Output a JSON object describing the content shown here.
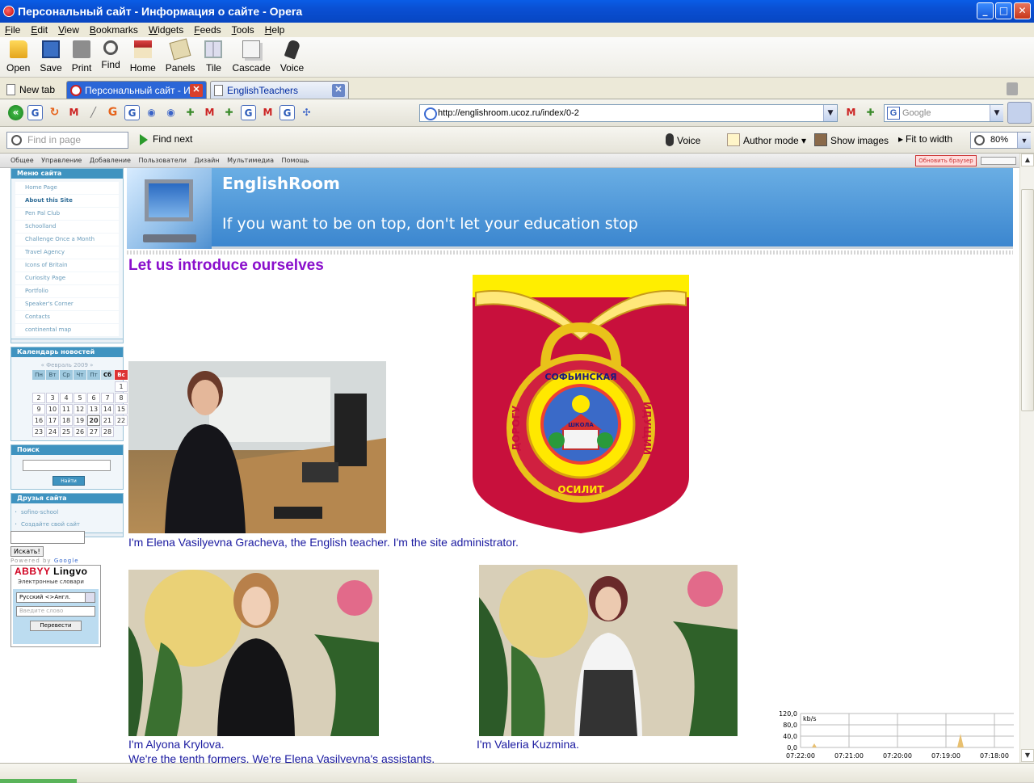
{
  "window": {
    "title": "Персональный сайт - Информация о сайте - Opera"
  },
  "menubar": [
    "File",
    "Edit",
    "View",
    "Bookmarks",
    "Widgets",
    "Feeds",
    "Tools",
    "Help"
  ],
  "toolbar": {
    "open": "Open",
    "save": "Save",
    "print": "Print",
    "find": "Find",
    "home": "Home",
    "panels": "Panels",
    "tile": "Tile",
    "cascade": "Cascade",
    "voice": "Voice"
  },
  "tabs": {
    "new_tab": "New tab",
    "active": "Персональный сайт - И...",
    "other": "EnglishTeachers"
  },
  "address": {
    "url": "http://englishroom.ucoz.ru/index/0-2",
    "search_placeholder": "Google"
  },
  "findbar": {
    "placeholder": "Find in page",
    "find_next": "Find next",
    "voice": "Voice",
    "author_mode": "Author mode",
    "show_images": "Show images",
    "fit_to_width": "Fit to width",
    "zoom": "80%"
  },
  "ucoz_panel": {
    "items": [
      "Общее",
      "Управление",
      "Добавление",
      "Пользователи",
      "Дизайн",
      "Мультимедиа",
      "Помощь"
    ],
    "refresh": "Обновить браузер"
  },
  "sidebar": {
    "menu_title": "Меню сайта",
    "menu_items": [
      "Home Page",
      "About this Site",
      "Pen Pal Club",
      "Schoolland",
      "Challenge Once a Month",
      "Travel Agency",
      "Icons of Britain",
      "Curiosity Page",
      "Portfolio",
      "Speaker's Corner",
      "Contacts",
      "continental map"
    ],
    "calendar_title": "Календарь новостей",
    "calendar_month": "« Февраль 2009 »",
    "calendar_headers": [
      "Пн",
      "Вт",
      "Ср",
      "Чт",
      "Пт",
      "Сб",
      "Вс"
    ],
    "calendar_weeks": [
      [
        "",
        "",
        "",
        "",
        "",
        "",
        "1"
      ],
      [
        "2",
        "3",
        "4",
        "5",
        "6",
        "7",
        "8"
      ],
      [
        "9",
        "10",
        "11",
        "12",
        "13",
        "14",
        "15"
      ],
      [
        "16",
        "17",
        "18",
        "19",
        "20",
        "21",
        "22"
      ],
      [
        "23",
        "24",
        "25",
        "26",
        "27",
        "28",
        ""
      ]
    ],
    "calendar_today": "20",
    "search_title": "Поиск",
    "search_button": "Найти",
    "friends_title": "Друзья сайта",
    "friends": [
      "sofino-school",
      "Создайте свой сайт"
    ],
    "google_button": "Искать!",
    "powered_by": "Powered by",
    "powered_google": "Google",
    "lingvo_logo_a": "ABBYY",
    "lingvo_logo_b": "Lingvo",
    "lingvo_sub": "Электронные словари",
    "lingvo_lang": "Русский <>Англ.",
    "lingvo_placeholder": "Введите слово",
    "lingvo_button": "Перевести"
  },
  "header": {
    "site_name": "EnglishRoom",
    "slogan": "If you want to be on top, don't let your education stop"
  },
  "content": {
    "intro_title": "Let us introduce ourselves",
    "emblem_top": "СОФЬИНСКАЯ",
    "emblem_school": "ШКОЛА",
    "emblem_left": "ДОРОГУ",
    "emblem_right": "ИДУЩИЙ",
    "emblem_bottom": "ОСИЛИТ",
    "caption1": "I'm Elena Vasilyevna Gracheva, the English teacher. I'm the site administrator.",
    "caption2": "I'm Alyona Krylova.",
    "caption2b": "We're the tenth formers. We're Elena Vasilyevna's assistants.",
    "caption3": "I'm Valeria Kuzmina."
  },
  "netmon": {
    "y_ticks": [
      "120,0",
      "80,0",
      "40,0",
      "0,0"
    ],
    "unit": "kb/s",
    "x_ticks": [
      "07:22:00",
      "07:21:00",
      "07:20:00",
      "07:19:00",
      "07:18:00"
    ]
  },
  "colors": {
    "titlebar": "#0a4fd2",
    "header_blue": "#3b86cf",
    "intro_purple": "#8a0fcc",
    "caption_blue": "#1a1aa0",
    "emblem_red": "#c8103c",
    "emblem_yellow": "#ffee00"
  }
}
